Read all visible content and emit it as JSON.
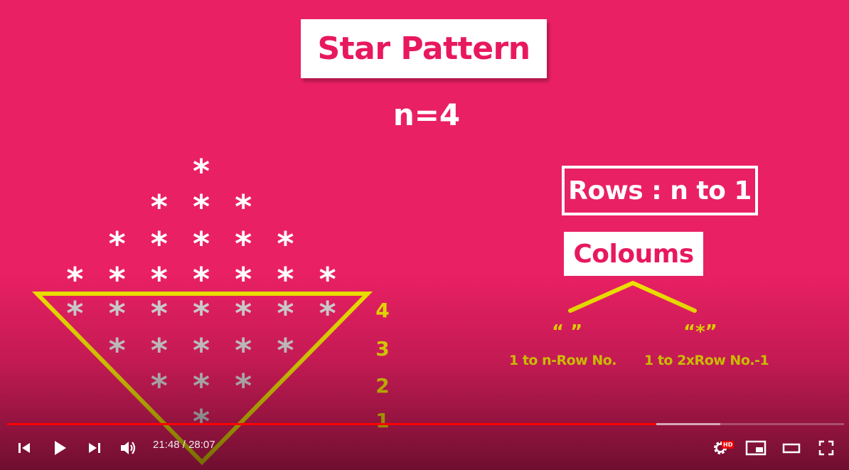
{
  "slide": {
    "title": "Star Pattern",
    "n_label": "n=4",
    "rows_label": "Rows : n to 1",
    "columns_label": "Coloums",
    "space_glyph": "“  ”",
    "star_glyph": "“*”",
    "space_desc": "1 to n-Row No.",
    "star_desc": "1 to 2xRow No.-1",
    "row_numbers": [
      "4",
      "3",
      "2",
      "1"
    ],
    "top_rows": [
      1,
      3,
      5,
      7
    ],
    "bottom_rows": [
      7,
      5,
      3,
      1
    ],
    "star_char": "*",
    "accent_color": "#e91e63",
    "highlight_color": "#f2e600"
  },
  "player": {
    "current_time": "21:48",
    "duration": "28:07",
    "time_display": "21:48 / 28:07",
    "progress_fraction": 0.776,
    "buffered_fraction": 0.852,
    "hd_badge": "HD",
    "icons": [
      "previous-icon",
      "play-icon",
      "next-icon",
      "volume-icon",
      "settings-icon",
      "miniplayer-icon",
      "theater-icon",
      "fullscreen-icon"
    ]
  }
}
